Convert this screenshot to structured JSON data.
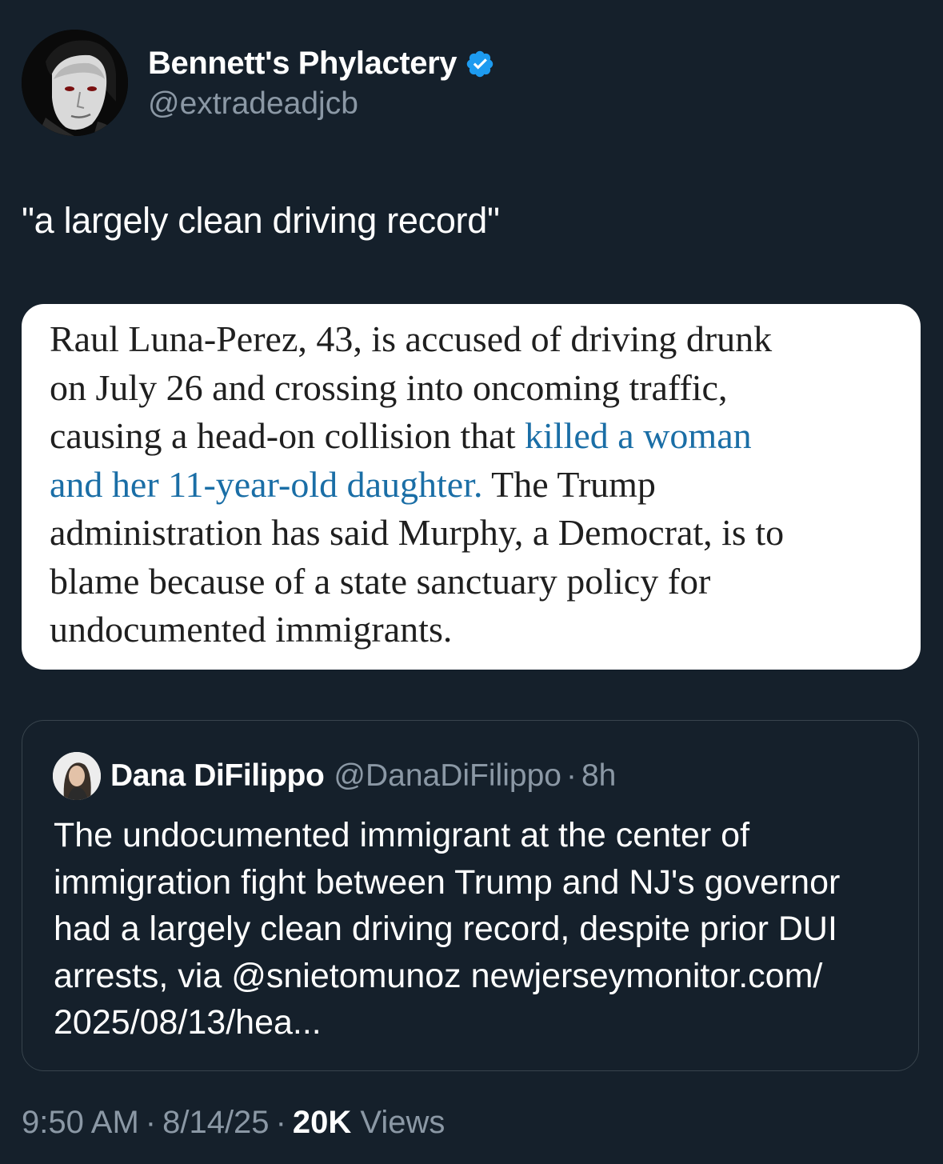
{
  "author": {
    "display_name": "Bennett's Phylactery",
    "handle": "@extradeadjcb",
    "verified_icon": "verified-badge-icon",
    "verified_color": "#1d9bf0"
  },
  "tweet": {
    "text": "\"a largely clean driving record\""
  },
  "media": {
    "lines": [
      {
        "before": "Raul Luna-Perez, 43, is accused of driving drunk",
        "link": "",
        "after": ""
      },
      {
        "before": "on July 26 and crossing into oncoming traffic,",
        "link": "",
        "after": ""
      },
      {
        "before": "causing a head-on collision that ",
        "link": "killed a woman",
        "after": ""
      },
      {
        "before": "",
        "link": "and her 11-year-old daughter.",
        "after": " The Trump"
      },
      {
        "before": "administration has said Murphy, a Democrat, is to",
        "link": "",
        "after": ""
      },
      {
        "before": "blame because of a state sanctuary policy for",
        "link": "",
        "after": ""
      },
      {
        "before": "undocumented immigrants.",
        "link": "",
        "after": ""
      }
    ],
    "link_color": "#1a6ea6"
  },
  "quote": {
    "display_name": "Dana DiFilippo",
    "handle": "@DanaDiFilippo",
    "separator": "·",
    "time": "8h",
    "lines": [
      "The undocumented immigrant at the center of",
      "immigration fight between Trump and NJ's governor",
      "had a largely clean driving record, despite prior DUI",
      "arrests, via @snietomunoz newjerseymonitor.com/",
      "2025/08/13/hea..."
    ]
  },
  "meta": {
    "time": "9:50 AM",
    "separator": "·",
    "date": "8/14/25",
    "views_count": "20K",
    "views_label": "Views"
  }
}
